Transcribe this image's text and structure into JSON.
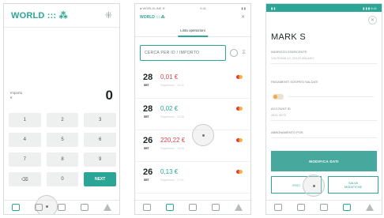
{
  "screen1": {
    "logo": "WORLD ::: ⁂",
    "grid_icon": "⁜",
    "amount_label_line1": "Importo",
    "amount_label_line2": "€",
    "amount_value": "0",
    "keys": [
      "1",
      "2",
      "3",
      "4",
      "5",
      "6",
      "7",
      "8",
      "9",
      "⌫",
      "0",
      "NEXT"
    ],
    "nav_icons": [
      "terminal-icon",
      "list-icon",
      "card-icon",
      "home-icon",
      "warning-icon"
    ]
  },
  "screen2": {
    "status_left": "● WORLDLINE ≋",
    "status_center": "9:41",
    "status_right": "▮ ▮",
    "brand": "WORLD ::: ⁂",
    "close": "✕",
    "tab_label": "Lista operazioni",
    "search_placeholder": "CERCA PER ID / IMPORTO",
    "transactions": [
      {
        "day": "28",
        "month": "SET",
        "amount": "0,01 €",
        "amount_color": "#d8454b",
        "detail": "Pagamento · 10:32"
      },
      {
        "day": "28",
        "month": "SET",
        "amount": "0,02 €",
        "amount_color": "#2aa596",
        "detail": "Pagamento · 10:28"
      },
      {
        "day": "26",
        "month": "SET",
        "amount": "220,22 €",
        "amount_color": "#d8454b",
        "detail": "Pagamento · 18:05"
      },
      {
        "day": "26",
        "month": "SET",
        "amount": "0,13 €",
        "amount_color": "#2aa596",
        "detail": "Pagamento · 17:51"
      }
    ]
  },
  "screen3": {
    "status_left": "▮ ▮",
    "status_right": "▮ ▮ ▮ 9:41",
    "close": "✕",
    "name": "MARK S",
    "field1_label": "INDIRIZZO ESERCENTE",
    "field1_value": "VIA ROMA 12, 20121 MILANO",
    "field2_label": "PAGAMENTI SOSPESI SALDATI",
    "field3_label": "ACCOUNT ID",
    "field3_value": "4521 8876",
    "field4_label": "ABBONAMENTO POS",
    "primary_button": "MODIFICA DATI",
    "left_button": "ESCI",
    "right_button_line1": "SALVA",
    "right_button_line2": "MODIFICHE"
  },
  "colors": {
    "accent": "#2aa596",
    "negative": "#d8454b",
    "warning": "#f0a945"
  }
}
